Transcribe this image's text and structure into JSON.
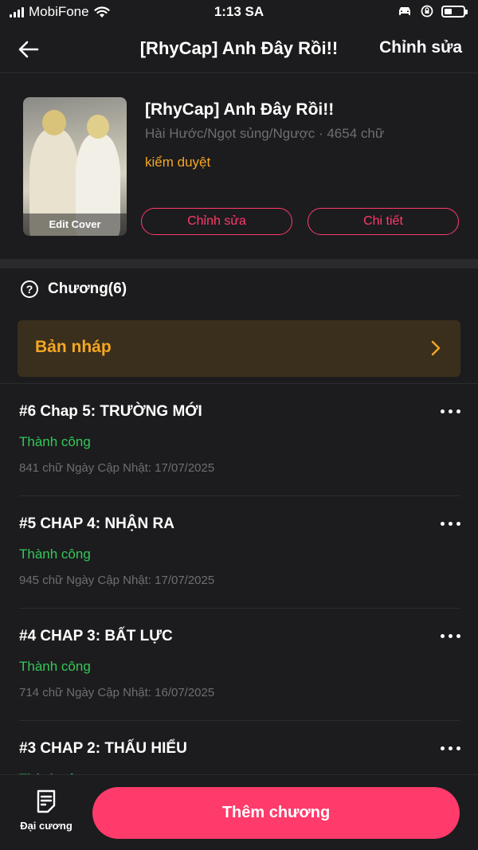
{
  "status_bar": {
    "carrier": "MobiFone",
    "time": "1:13 SA"
  },
  "nav": {
    "title": "[RhyCap] Anh Đây Rồi!!",
    "edit_label": "Chỉnh sửa"
  },
  "book": {
    "cover_label": "Edit Cover",
    "title": "[RhyCap] Anh Đây Rồi!!",
    "meta": "Hài Hước/Ngọt sủng/Ngược · 4654 chữ",
    "status": "kiểm duyệt",
    "edit_button": "Chỉnh sửa",
    "detail_button": "Chi tiết"
  },
  "chapters_header": "Chương(6)",
  "draft_label": "Bản nháp",
  "chapters": [
    {
      "title": "#6 Chap 5: TRƯỜNG MỚI",
      "state": "Thành công",
      "info": "841 chữ Ngày Cập Nhật: 17/07/2025"
    },
    {
      "title": "#5 CHAP 4: NHẬN RA",
      "state": "Thành công",
      "info": "945 chữ Ngày Cập Nhật: 17/07/2025"
    },
    {
      "title": "#4 CHAP 3: BẤT LỰC",
      "state": "Thành công",
      "info": "714 chữ Ngày Cập Nhật: 16/07/2025"
    },
    {
      "title": "#3 CHAP 2: THẤU HIỂU",
      "state": "Thành công",
      "info": ""
    }
  ],
  "bottom": {
    "outline_label": "Đại cương",
    "add_chapter_label": "Thêm chương"
  },
  "colors": {
    "accent": "#ff3b6b",
    "warning": "#f5a623",
    "success": "#34c759",
    "background": "#1c1c1e"
  },
  "icons": [
    "signal-icon",
    "wifi-icon",
    "car-icon",
    "rotation-lock-icon",
    "battery-icon",
    "back-arrow-icon",
    "help-icon",
    "chevron-right-icon",
    "more-icon",
    "outline-icon"
  ]
}
